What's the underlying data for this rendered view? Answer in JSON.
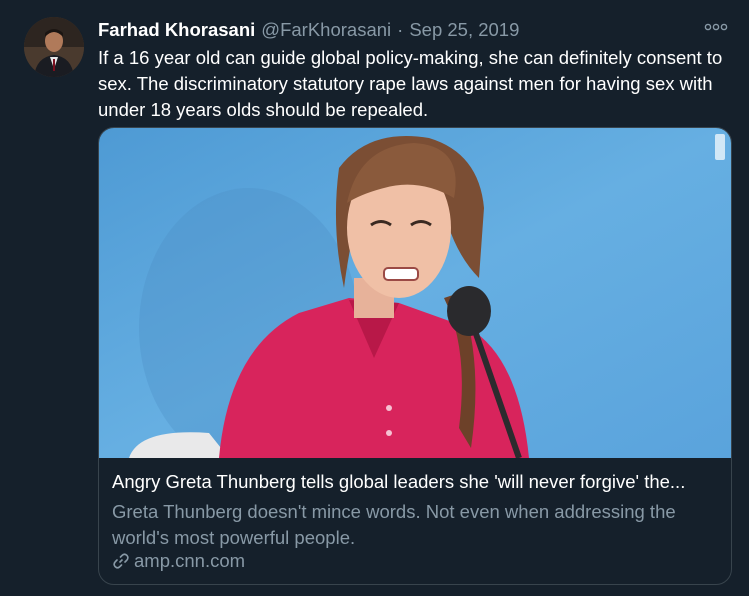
{
  "author": {
    "name": "Farhad Khorasani",
    "handle": "@FarKhorasani",
    "separator": "·",
    "date": "Sep 25, 2019"
  },
  "more_icon": "more-options-icon",
  "tweet": {
    "text": "If a 16 year old can guide global policy-making, she can definitely consent to sex. The discriminatory statutory rape laws against men for having sex with under 18 years olds should be repealed."
  },
  "card": {
    "title": "Angry Greta Thunberg tells global leaders she 'will never forgive' the...",
    "description": "Greta Thunberg doesn't mince words. Not even when addressing the world's most powerful people.",
    "domain": "amp.cnn.com",
    "link_icon": "link-icon"
  },
  "colors": {
    "background": "#15202b",
    "secondary_text": "#8899a6",
    "border": "#38444d",
    "photo_background": "#5fa6dc",
    "shirt": "#d8245c"
  }
}
